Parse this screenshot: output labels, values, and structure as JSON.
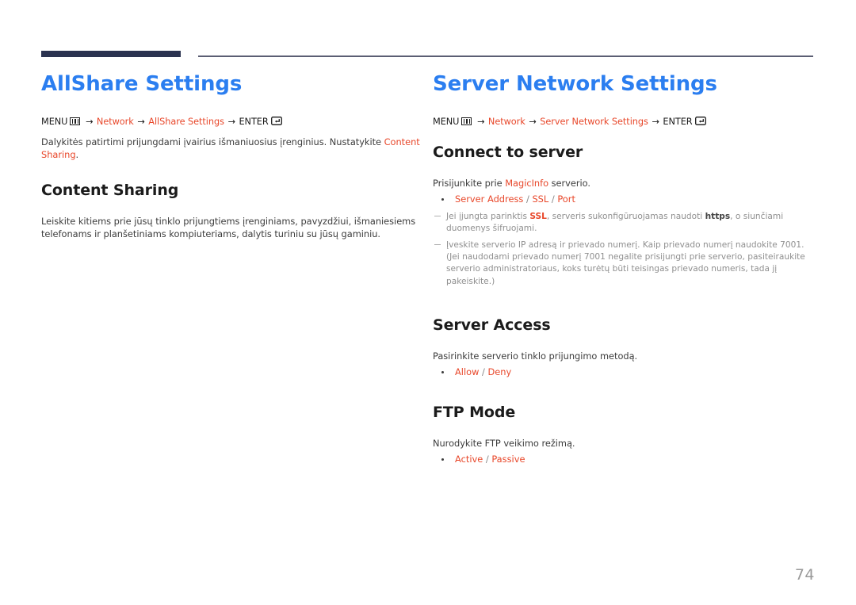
{
  "document": {
    "page_number": "74",
    "colors": {
      "title_blue": "#2b7ef0",
      "accent_orange": "#e8472a",
      "rule_navy": "#2b3350",
      "rule_thin": "#5b5e73",
      "body_gray": "#3c3c3c",
      "note_gray": "#8f8f8f",
      "page_number_gray": "#999999"
    }
  },
  "left_column": {
    "title": "AllShare Settings",
    "breadcrumb": {
      "menu_label": "MENU",
      "menu_icon": "menu-grid-icon",
      "arrow": "→",
      "step1": "Network",
      "step2": "AllShare Settings",
      "enter_label": "ENTER",
      "enter_icon": "enter-return-icon"
    },
    "intro": {
      "text_before": "Dalykitės patirtimi prijungdami įvairius išmaniuosius įrenginius. Nustatykite ",
      "accent": "Content Sharing",
      "text_after": "."
    },
    "section": {
      "heading": "Content Sharing",
      "body": "Leiskite kitiems prie jūsų tinklo prijungtiems įrenginiams, pavyzdžiui, išmaniesiems telefonams ir planšetiniams kompiuteriams, dalytis turiniu su jūsų gaminiu."
    }
  },
  "right_column": {
    "title": "Server Network Settings",
    "breadcrumb": {
      "menu_label": "MENU",
      "menu_icon": "menu-grid-icon",
      "arrow": "→",
      "step1": "Network",
      "step2": "Server Network Settings",
      "enter_label": "ENTER",
      "enter_icon": "enter-return-icon"
    },
    "sections": [
      {
        "heading": "Connect to server",
        "intro_before": "Prisijunkite prie ",
        "intro_accent": "MagicInfo",
        "intro_after": " serverio.",
        "options": [
          {
            "label": "Server Address",
            "sep": " / "
          },
          {
            "label": "SSL",
            "sep": " / "
          },
          {
            "label": "Port",
            "sep": ""
          }
        ],
        "options_line": "Server Address / SSL / Port",
        "notes": [
          {
            "p1": "Jei įjungta parinktis ",
            "a1": "SSL",
            "p2": ", serveris sukonfigūruojamas naudoti ",
            "a2": "https",
            "p3": ", o siunčiami duomenys šifruojami."
          },
          {
            "p1": "Įveskite serverio IP adresą ir prievado numerį. Kaip prievado numerį naudokite 7001. (Jei naudodami prievado numerį 7001 negalite prisijungti prie serverio, pasiteiraukite serverio administratoriaus, koks turėtų būti teisingas prievado numeris, tada jį pakeiskite.)",
            "a1": "",
            "p2": "",
            "a2": "",
            "p3": ""
          }
        ]
      },
      {
        "heading": "Server Access",
        "intro": "Pasirinkite serverio tinklo prijungimo metodą.",
        "options": [
          {
            "label": "Allow",
            "sep": " / "
          },
          {
            "label": "Deny",
            "sep": ""
          }
        ],
        "options_line": "Allow / Deny"
      },
      {
        "heading": "FTP Mode",
        "intro": "Nurodykite FTP veikimo režimą.",
        "options": [
          {
            "label": "Active",
            "sep": " / "
          },
          {
            "label": "Passive",
            "sep": ""
          }
        ],
        "options_line": "Active / Passive"
      }
    ]
  }
}
